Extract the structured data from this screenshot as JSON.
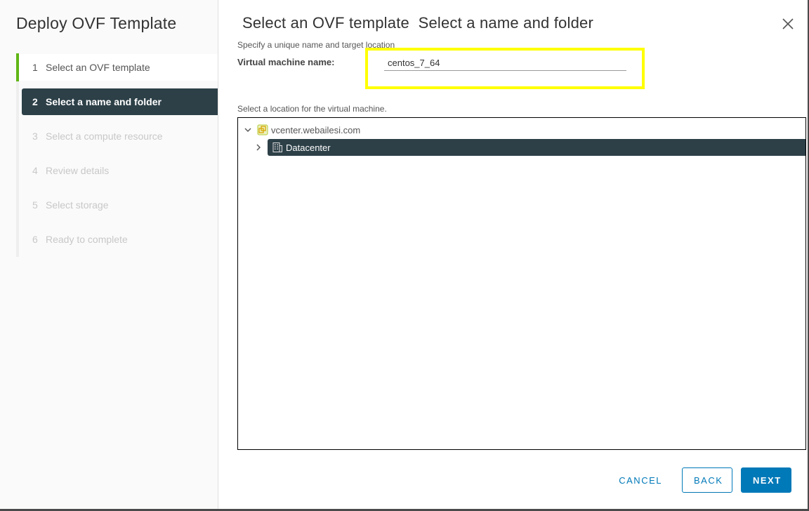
{
  "sidebar": {
    "title": "Deploy OVF Template",
    "steps": [
      {
        "num": "1",
        "label": "Select an OVF template",
        "state": "done"
      },
      {
        "num": "2",
        "label": "Select a name and folder",
        "state": "current"
      },
      {
        "num": "3",
        "label": "Select a compute resource",
        "state": "pending"
      },
      {
        "num": "4",
        "label": "Review details",
        "state": "pending"
      },
      {
        "num": "5",
        "label": "Select storage",
        "state": "pending"
      },
      {
        "num": "6",
        "label": "Ready to complete",
        "state": "pending"
      }
    ]
  },
  "main": {
    "title": "Select an OVF template  Select a name and folder",
    "subtitle": "Specify a unique name and target location",
    "vm_name_label": "Virtual machine name:",
    "vm_name_value": "centos_7_64",
    "location_label": "Select a location for the virtual machine.",
    "tree": {
      "root": {
        "label": "vcenter.webailesi.com",
        "icon": "vcenter-icon",
        "expanded": true
      },
      "children": [
        {
          "label": "Datacenter",
          "icon": "datacenter-icon",
          "expanded": false,
          "selected": true
        }
      ]
    }
  },
  "footer": {
    "cancel_label": "CANCEL",
    "back_label": "BACK",
    "next_label": "NEXT"
  },
  "colors": {
    "accent": "#0079b8",
    "selected_bg": "#2d4048",
    "progress_green": "#60b515",
    "highlight": "#ffff00"
  }
}
